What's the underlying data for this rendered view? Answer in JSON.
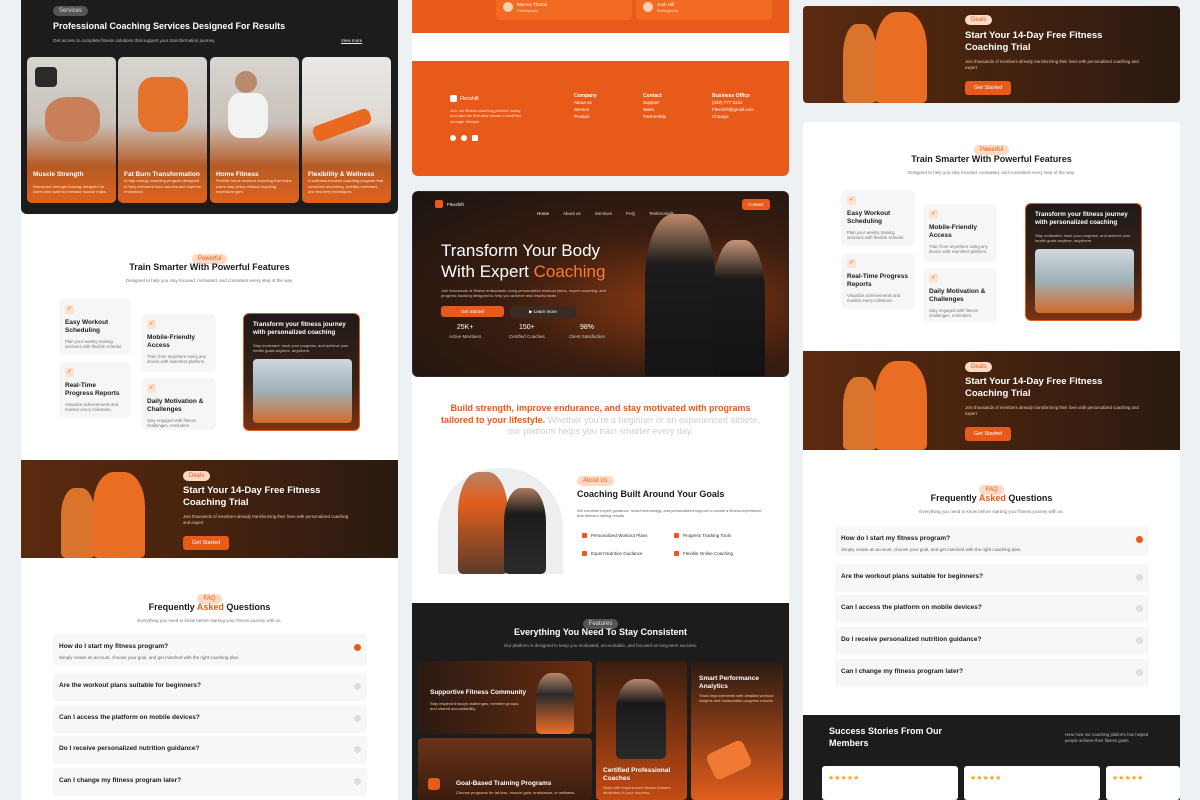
{
  "col1": {
    "services": {
      "pill": "Services",
      "title": "Professional Coaching Services Designed For Results",
      "subtitle": "Get access to complete fitness solutions that support your transformation journey.",
      "view_more": "View more",
      "tiles": [
        {
          "title": "Muscle Strength",
          "desc": "Structured strength training designed for users who want to increase muscle mass."
        },
        {
          "title": "Fat Burn Transformation",
          "desc": "A high-energy coaching program designed to help members burn calories and improve endurance."
        },
        {
          "title": "Home Fitness",
          "desc": "Flexible home workout coaching that helps users stay active without requiring expensive gym"
        },
        {
          "title": "Flexibility & Wellness",
          "desc": "A wellness-focused coaching program that combines stretching, mobility exercises, and recovery techniques"
        }
      ]
    },
    "features": {
      "pill": "Powerful",
      "title": "Train Smarter With Powerful Features",
      "subtitle": "Designed to help you stay focused, motivated, and consistent every step of the way.",
      "items": [
        {
          "title": "Easy Workout Scheduling",
          "desc": "Plan your weekly training sessions with flexible schedul."
        },
        {
          "title": "Mobile-Friendly Access",
          "desc": "Train from anywhere using any device with seamless platform."
        },
        {
          "title": "Real-Time Progress Reports",
          "desc": "Visualize achievements and monitor every milestone."
        },
        {
          "title": "Daily Motivation & Challenges",
          "desc": "Stay engaged with fitness challenges, reminders."
        }
      ],
      "promo_title": "Transform your fitness journey with personalized coaching",
      "promo_desc": "Stay motivated, track your progress, and achieve your health goals anytime, anywhere."
    },
    "trial": {
      "pill": "Deals",
      "title": "Start Your 14-Day Free Fitness Coaching Trial",
      "desc": "Join thousands of members already transforming their lives with personalized coaching and expert",
      "button": "Get Started"
    },
    "faq": {
      "pill": "FAQ",
      "title_a": "Frequently ",
      "title_b": "Asked",
      "title_c": " Questions",
      "subtitle": "Everything you need to know before starting your fitness journey with us.",
      "items": [
        {
          "q": "How do I start my fitness program?",
          "a": "Simply create an account, choose your goal, and get matched with the right coaching plan."
        },
        {
          "q": "Are the workout plans suitable for beginners?"
        },
        {
          "q": "Can I access the platform on mobile devices?"
        },
        {
          "q": "Do I receive personalized nutrition guidance?"
        },
        {
          "q": "Can I change my fitness program later?"
        }
      ]
    }
  },
  "col2": {
    "top_reviews": [
      {
        "name": "Marcus Thorne",
        "role": "Participants"
      },
      {
        "name": "Josh Hill",
        "role": "Participants"
      }
    ],
    "footer": {
      "brand": "Flexshift",
      "about": "Join our fitness coaching platform today and take the first step toward a healthier, stronger lifestyle.",
      "cols": [
        {
          "head": "Company",
          "links": [
            "About us",
            "Service",
            "Product"
          ]
        },
        {
          "head": "Contact",
          "links": [
            "Support",
            "Sales",
            "Partnership"
          ]
        },
        {
          "head": "Business Office",
          "links": [
            "(432) 777 2222",
            "Flexshift@gmail.com",
            "Chicago"
          ]
        }
      ]
    },
    "hero": {
      "brand": "Flexshift",
      "nav": [
        "Home",
        "About us",
        "Services",
        "FAQ",
        "Testimonials"
      ],
      "contact": "Contact",
      "title_a": "Transform Your Body",
      "title_b": "With Expert ",
      "title_c": "Coaching",
      "desc": "Join thousands of fitness enthusiasts using personalized workout plans, expert coaching, and progress tracking designed to help you achieve real results faster.",
      "cta_primary": "Get Started",
      "cta_secondary": "Learn more",
      "stats": [
        {
          "value": "25K+",
          "label": "Active Members"
        },
        {
          "value": "150+",
          "label": "Certified Coaches"
        },
        {
          "value": "98%",
          "label": "Client Satisfaction"
        }
      ]
    },
    "mission": {
      "bold": "Build strength, improve endurance, and stay motivated with programs tailored to your lifestyle.",
      "light": " Whether you're a beginner or an experienced athlete, our platform helps you train smarter every day."
    },
    "about": {
      "pill": "About Us",
      "title": "Coaching Built Around Your Goals",
      "desc": "We combine expert guidance, smart technology, and personalized support to create a fitness experience that delivers lasting results",
      "features": [
        "Personalized Workout Plans",
        "Progress Tracking Tools",
        "Expert Nutrition Guidance",
        "Flexible Online Coaching"
      ]
    },
    "consistent": {
      "pill": "Features",
      "title": "Everything You Need To Stay Consistent",
      "subtitle": "Our platform is designed to keep you motivated, accountable, and focused on long-term success.",
      "tiles": [
        {
          "title": "Supportive Fitness Community",
          "desc": "Stay inspired through challenges, member groups, and shared accountability."
        },
        {
          "title": "Certified Professional Coaches",
          "desc": "Work with experienced fitness trainers dedicated to your success."
        },
        {
          "title": "Smart Performance Analytics",
          "desc": "Track improvements with detailed workout insights and measurable progress reports."
        },
        {
          "title": "Goal-Based Training Programs",
          "desc": "Choose programs for fat loss, muscle gain, endurance, or wellness."
        }
      ]
    }
  },
  "col3": {
    "trial_top": {
      "pill": "Deals",
      "title": "Start Your 14-Day Free Fitness Coaching Trial",
      "desc": "Join thousands of members already transforming their lives with personalized coaching and expert",
      "button": "Get Started"
    },
    "features": {
      "pill": "Powerful",
      "title": "Train Smarter With Powerful Features",
      "subtitle": "Designed to help you stay focused, motivated, and consistent every step of the way.",
      "items": [
        {
          "title": "Easy Workout Scheduling",
          "desc": "Plan your weekly training sessions with flexible schedul."
        },
        {
          "title": "Mobile-Friendly Access",
          "desc": "Train from anywhere using any device with seamless platform."
        },
        {
          "title": "Real-Time Progress Reports",
          "desc": "Visualize achievements and monitor every milestone."
        },
        {
          "title": "Daily Motivation & Challenges",
          "desc": "Stay engaged with fitness challenges, reminders."
        }
      ],
      "promo_title": "Transform your fitness journey with personalized coaching",
      "promo_desc": "Stay motivated, track your progress, and achieve your health goals anytime, anywhere."
    },
    "trial": {
      "pill": "Deals",
      "title": "Start Your 14-Day Free Fitness Coaching Trial",
      "desc": "Join thousands of members already transforming their lives with personalized coaching and expert",
      "button": "Get Started"
    },
    "faq": {
      "pill": "FAQ",
      "title_a": "Frequently ",
      "title_b": "Asked",
      "title_c": " Questions",
      "subtitle": "Everything you need to know before starting your fitness journey with us.",
      "items": [
        {
          "q": "How do I start my fitness program?",
          "a": "Simply create an account, choose your goal, and get matched with the right coaching plan."
        },
        {
          "q": "Are the workout plans suitable for beginners?"
        },
        {
          "q": "Can I access the platform on mobile devices?"
        },
        {
          "q": "Do I receive personalized nutrition guidance?"
        },
        {
          "q": "Can I change my fitness program later?"
        }
      ]
    },
    "stories": {
      "title": "Success Stories From Our Members",
      "desc": "Hear how our coaching platform has helped people achieve their fitness goals.",
      "stars": "★★★★★"
    }
  },
  "colors": {
    "accent": "#e85a1a",
    "dark": "#1c1c1c",
    "light_bg": "#eef1f3"
  }
}
